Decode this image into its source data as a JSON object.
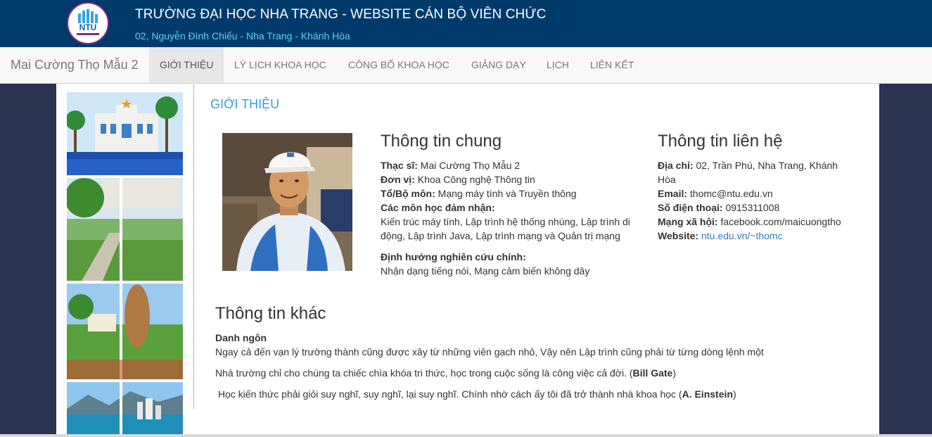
{
  "header": {
    "logo_text": "NTU",
    "title": "TRƯỜNG ĐẠI HỌC NHA TRANG - WEBSITE CÁN BỘ VIÊN CHỨC",
    "address": "02, Nguyễn Đình Chiểu - Nha Trang - Khánh Hòa"
  },
  "nav": {
    "brand": "Mai Cường Thọ Mẫu 2",
    "items": [
      {
        "label": "GIỚI THIỆU"
      },
      {
        "label": "LÝ LỊCH KHOA HỌC"
      },
      {
        "label": "CÔNG BỐ KHOA HỌC"
      },
      {
        "label": "GIẢNG DẠY"
      },
      {
        "label": "LỊCH"
      },
      {
        "label": "LIÊN KẾT"
      }
    ]
  },
  "main": {
    "section_title": "GIỚI THIỆU",
    "general": {
      "heading": "Thông tin chung",
      "degree_label": "Thạc sĩ:",
      "degree_value": "Mai Cường Thọ Mẫu 2",
      "unit_label": "Đơn vị:",
      "unit_value": "Khoa Công nghệ Thông tin",
      "dept_label": "Tổ/Bộ môn:",
      "dept_value": "Mạng máy tính và Truyền thông",
      "courses_label": "Các môn học đảm nhận:",
      "courses_value": "Kiến trúc máy tính, Lập trình hệ thống nhúng, Lập trình di động, Lập trình Java, Lập trình mạng và Quản trị mạng",
      "research_label": "Định hướng nghiên cứu chính:",
      "research_value": "Nhận dạng tiếng nói, Mạng cảm biến không dây"
    },
    "contact": {
      "heading": "Thông tin liên hệ",
      "address_label": "Địa chỉ:",
      "address_value": "02, Trần Phú, Nha Trang, Khánh Hòa",
      "email_label": "Email:",
      "email_value": "thomc@ntu.edu.vn",
      "phone_label": "Số điện thoại:",
      "phone_value": "0915311008",
      "social_label": "Mạng xã hội:",
      "social_value": "facebook.com/maicuongtho",
      "website_label": "Website:",
      "website_value": "ntu.edu.vn/~thomc"
    },
    "other": {
      "heading": "Thông tin khác",
      "quotes_label": "Danh ngôn",
      "quote1": "Ngay cả đến vạn lý trường thành cũng được xây từ những viên gạch nhỏ, Vậy nên Lập trình cũng phải từ từng dòng lệnh một",
      "quote2_text": "Nhà trường chỉ cho chúng ta chiếc chìa khóa tri thức, học trong cuộc sống là công việc cả đời. (",
      "quote2_author": "Bill Gate",
      "quote2_end": ")",
      "quote3_text": " Học kiến thức phải giỏi suy nghĩ, suy nghĩ, lại suy nghĩ. Chính nhờ cách ấy tôi đã trở thành nhà khoa học (",
      "quote3_author": "A. Einstein",
      "quote3_end": ")"
    }
  },
  "colors": {
    "header_bg": "#003a6b",
    "address_text": "#5ad3f5",
    "section_title": "#3a9ad9",
    "link": "#337ab7",
    "page_bg": "#2b3450"
  }
}
